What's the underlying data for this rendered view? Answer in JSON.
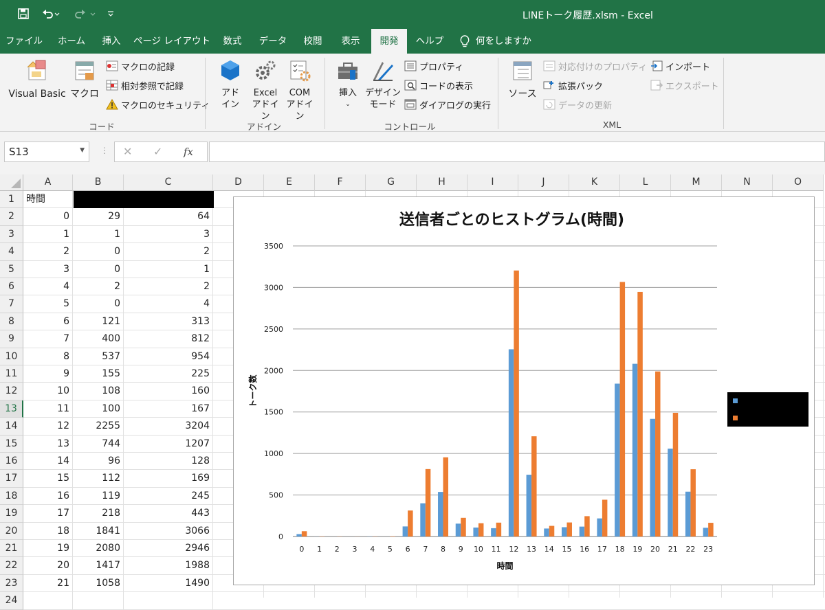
{
  "titlebar": {
    "title": "LINEトーク履歴.xlsm  -  Excel",
    "undo_icon": "undo-icon",
    "redo_icon": "redo-icon",
    "save_icon": "save-icon"
  },
  "tabs": [
    "ファイル",
    "ホーム",
    "挿入",
    "ページ レイアウト",
    "数式",
    "データ",
    "校閲",
    "表示",
    "開発",
    "ヘルプ"
  ],
  "active_tab": "開発",
  "tell_me": "何をしますか",
  "ribbon": {
    "code": {
      "visual_basic": "Visual Basic",
      "macro": "マクロ",
      "record_macro": "マクロの記録",
      "relative_ref": "相対参照で記録",
      "macro_security": "マクロのセキュリティ",
      "group_label": "コード"
    },
    "addins": {
      "addins": [
        "アド",
        "イン"
      ],
      "excel_addins": [
        "Excel",
        "アドイン"
      ],
      "com_addins": [
        "COM",
        "アドイン"
      ],
      "group_label": "アドイン"
    },
    "controls": {
      "insert": "挿入",
      "design_mode": [
        "デザイン",
        "モード"
      ],
      "properties": "プロパティ",
      "view_code": "コードの表示",
      "run_dialog": "ダイアログの実行",
      "group_label": "コントロール"
    },
    "xml": {
      "source": "ソース",
      "map_properties": "対応付けのプロパティ",
      "expansion_packs": "拡張パック",
      "refresh_data": "データの更新",
      "import": "インポート",
      "export": "エクスポート",
      "group_label": "XML"
    }
  },
  "formula_bar": {
    "name_box": "S13",
    "fx": "fx",
    "formula": ""
  },
  "grid": {
    "columns": [
      "A",
      "B",
      "C",
      "D",
      "E",
      "F",
      "G",
      "H",
      "I",
      "J",
      "K",
      "L",
      "M",
      "N",
      "O"
    ],
    "header_row": [
      "時間",
      "",
      ""
    ],
    "rows": [
      [
        0,
        29,
        64
      ],
      [
        1,
        1,
        3
      ],
      [
        2,
        0,
        2
      ],
      [
        3,
        0,
        1
      ],
      [
        4,
        2,
        2
      ],
      [
        5,
        0,
        4
      ],
      [
        6,
        121,
        313
      ],
      [
        7,
        400,
        812
      ],
      [
        8,
        537,
        954
      ],
      [
        9,
        155,
        225
      ],
      [
        10,
        108,
        160
      ],
      [
        11,
        100,
        167
      ],
      [
        12,
        2255,
        3204
      ],
      [
        13,
        744,
        1207
      ],
      [
        14,
        96,
        128
      ],
      [
        15,
        112,
        169
      ],
      [
        16,
        119,
        245
      ],
      [
        17,
        218,
        443
      ],
      [
        18,
        1841,
        3066
      ],
      [
        19,
        2080,
        2946
      ],
      [
        20,
        1417,
        1988
      ],
      [
        21,
        1058,
        1490
      ]
    ],
    "selected_row": 13
  },
  "chart_data": {
    "type": "bar",
    "title": "送信者ごとのヒストグラム(時間)",
    "xlabel": "時間",
    "ylabel": "トーク数",
    "ylim": [
      0,
      3500
    ],
    "yticks": [
      0,
      500,
      1000,
      1500,
      2000,
      2500,
      3000,
      3500
    ],
    "grid": true,
    "legend_position": "right",
    "categories": [
      "0",
      "1",
      "2",
      "3",
      "4",
      "5",
      "6",
      "7",
      "8",
      "9",
      "10",
      "11",
      "12",
      "13",
      "14",
      "15",
      "16",
      "17",
      "18",
      "19",
      "20",
      "21",
      "22",
      "23"
    ],
    "series": [
      {
        "color": "#5b9bd5",
        "values": [
          29,
          1,
          0,
          0,
          2,
          0,
          121,
          400,
          537,
          155,
          108,
          100,
          2255,
          744,
          96,
          112,
          119,
          218,
          1841,
          2080,
          1417,
          1058,
          540,
          105
        ]
      },
      {
        "color": "#ed7d31",
        "values": [
          64,
          3,
          2,
          1,
          2,
          4,
          313,
          812,
          954,
          225,
          160,
          167,
          3204,
          1207,
          128,
          169,
          245,
          443,
          3066,
          2946,
          1988,
          1490,
          810,
          165
        ]
      }
    ]
  }
}
